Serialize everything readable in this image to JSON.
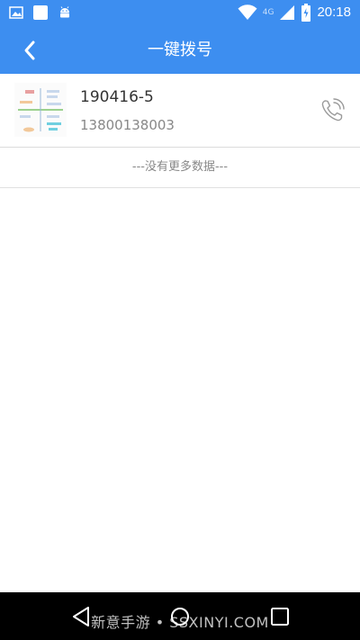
{
  "status_bar": {
    "time": "20:18",
    "network": "4G",
    "icons": [
      "image-icon",
      "notification-square-icon",
      "android-icon",
      "wifi-icon",
      "signal-icon",
      "battery-icon"
    ]
  },
  "header": {
    "title": "一键拨号",
    "back_icon": "chevron-left-icon"
  },
  "contacts": [
    {
      "name": "190416-5",
      "phone": "13800138003",
      "call_icon": "phone-call-icon"
    }
  ],
  "list_footer": "---没有更多数据---",
  "nav_bar": {
    "buttons": [
      "back-triangle-icon",
      "home-circle-icon",
      "recents-square-icon"
    ],
    "watermark": "新意手游 • SSXINYI.COM"
  },
  "colors": {
    "primary": "#3d8ef0",
    "text_primary": "#333333",
    "text_secondary": "#888888",
    "divider": "#dcdcdc"
  }
}
